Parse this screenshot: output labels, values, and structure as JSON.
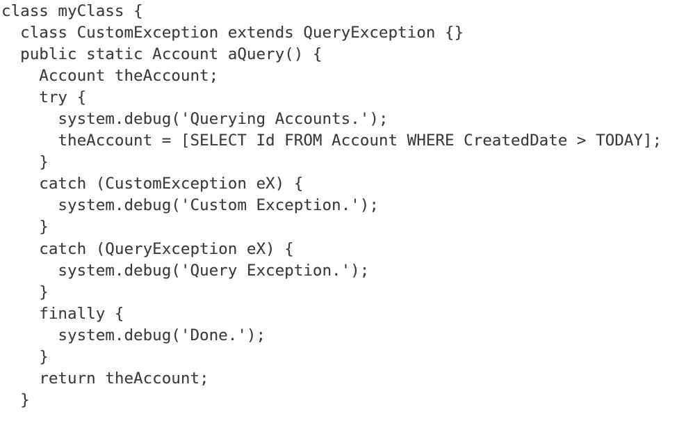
{
  "document": {
    "type": "code-listing",
    "language": "Apex",
    "background_color": "#ffffff",
    "text_color": "#3b3b3d",
    "line_count": 19
  },
  "code": {
    "lines": [
      "class myClass {",
      "  class CustomException extends QueryException {}",
      "  public static Account aQuery() {",
      "    Account theAccount;",
      "    try {",
      "      system.debug('Querying Accounts.');",
      "      theAccount = [SELECT Id FROM Account WHERE CreatedDate > TODAY];",
      "    }",
      "    catch (CustomException eX) {",
      "      system.debug('Custom Exception.');",
      "    }",
      "    catch (QueryException eX) {",
      "      system.debug('Query Exception.');",
      "    }",
      "    finally {",
      "      system.debug('Done.');",
      "    }",
      "    return theAccount;",
      "  }",
      "}"
    ]
  }
}
